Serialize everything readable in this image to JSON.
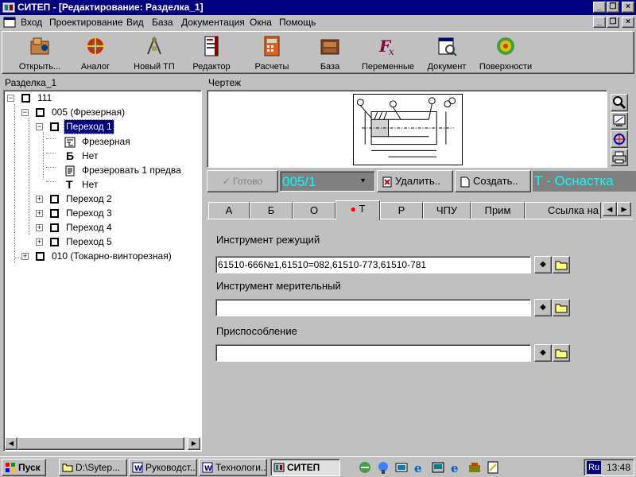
{
  "window": {
    "title": "СИТЕП - [Редактирование: Разделка_1]"
  },
  "menu": [
    "Вход",
    "Проектирование",
    "Вид",
    "База",
    "Документация",
    "Окна",
    "Помощь"
  ],
  "toolbar": [
    {
      "label": "Открыть...",
      "icon": "open-icon"
    },
    {
      "label": "Аналог",
      "icon": "analog-icon"
    },
    {
      "label": "Новый ТП",
      "icon": "new-process-icon"
    },
    {
      "label": "Редактор",
      "icon": "editor-icon"
    },
    {
      "label": "Расчеты",
      "icon": "calculator-icon"
    },
    {
      "label": "База",
      "icon": "database-icon"
    },
    {
      "label": "Переменные",
      "icon": "variables-icon"
    },
    {
      "label": "Документ",
      "icon": "document-icon"
    },
    {
      "label": "Поверхности",
      "icon": "surfaces-icon"
    }
  ],
  "left_panel": {
    "title": "Разделка_1",
    "tree": [
      {
        "label": "111"
      },
      {
        "label": "005 (Фрезерная)"
      },
      {
        "label": "Переход 1"
      },
      {
        "label": "Фрезерная"
      },
      {
        "label": "Нет",
        "glyph": "Б"
      },
      {
        "label": "Фрезеровать 1 предва"
      },
      {
        "label": "Нет",
        "glyph": "Т"
      },
      {
        "label": "Переход 2"
      },
      {
        "label": "Переход 3"
      },
      {
        "label": "Переход 4"
      },
      {
        "label": "Переход 5"
      },
      {
        "label": "010 (Токарно-винторезная)"
      }
    ]
  },
  "drawing_panel": {
    "title": "Чертеж"
  },
  "status": {
    "ready": "Готово",
    "code": "005/1",
    "delete": "Удалить..",
    "create": "Создать..",
    "section": "Т - Оснастка"
  },
  "tabs": [
    "А",
    "Б",
    "О",
    "Т",
    "Р",
    "ЧПУ",
    "Прим",
    "Ссылка на"
  ],
  "active_tab": "Т",
  "form": {
    "cutting_tool_label": "Инструмент режущий",
    "cutting_tool_value": "61510-666№1,61510=082,61510-773,61510-781",
    "measuring_tool_label": "Инструмент мерительный",
    "measuring_tool_value": "",
    "fixture_label": "Приспособление",
    "fixture_value": ""
  },
  "taskbar": {
    "start": "Пуск",
    "tasks": [
      "D:\\Sytep...",
      "Руководст...",
      "Технологи...",
      "СИТЕП"
    ],
    "lang": "Ru",
    "clock": "13:48"
  },
  "colors": {
    "title_bar": "#000080",
    "accent_cyan": "#00ffff",
    "panel_gray": "#808080"
  }
}
